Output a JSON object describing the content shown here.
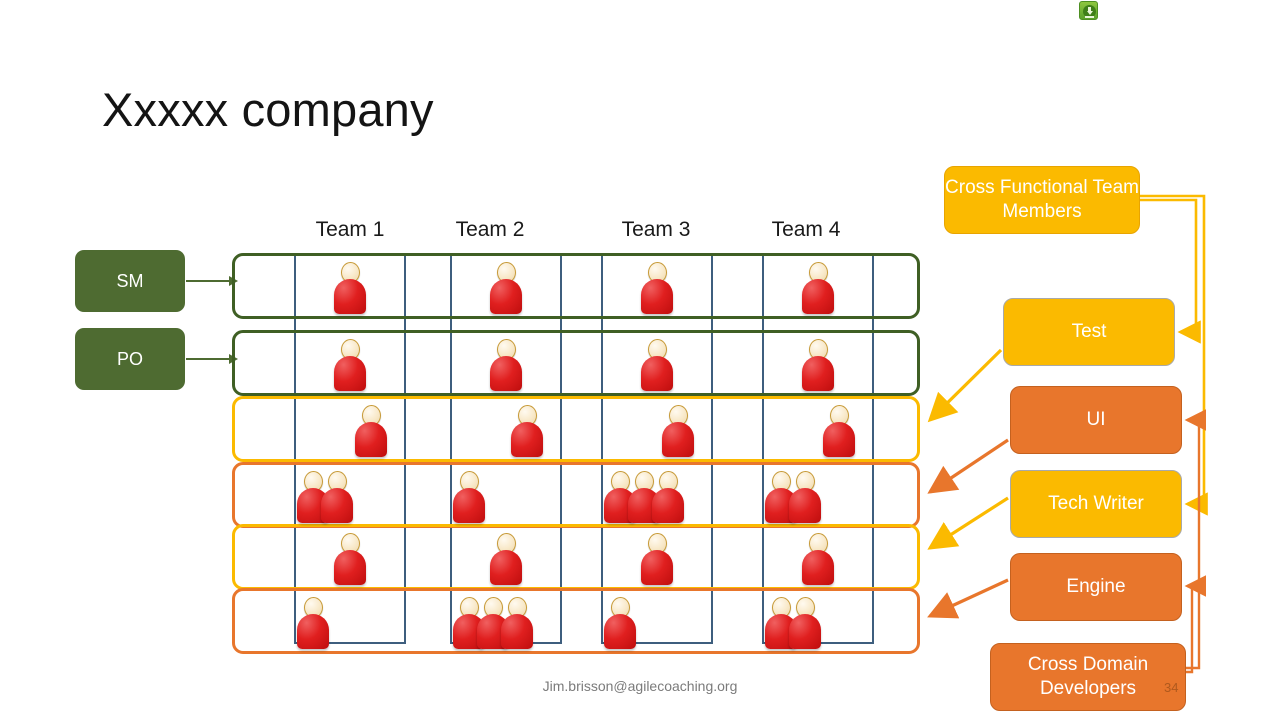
{
  "slide": {
    "title": "Xxxxx company",
    "footer": "Jim.brisson@agilecoaching.org",
    "page_number": "34"
  },
  "icons": {
    "download_badge": "download-icon"
  },
  "roles": [
    {
      "id": "sm",
      "label": "SM",
      "color": "#4e6b31"
    },
    {
      "id": "po",
      "label": "PO",
      "color": "#4e6b31"
    }
  ],
  "teams": [
    {
      "label": "Team 1"
    },
    {
      "label": "Team 2"
    },
    {
      "label": "Team 3"
    },
    {
      "label": "Team 4"
    }
  ],
  "grid": {
    "column_border_color": "#3e5e7e",
    "rows": [
      {
        "id": "row-sm",
        "border_color": "#3f5f24",
        "role": "SM",
        "counts": [
          1,
          1,
          1,
          1
        ],
        "offset": "center"
      },
      {
        "id": "row-po",
        "border_color": "#3f5f24",
        "role": "PO",
        "counts": [
          1,
          1,
          1,
          1
        ],
        "offset": "center"
      },
      {
        "id": "row-test",
        "border_color": "#fbba00",
        "role": "Test",
        "counts": [
          1,
          1,
          1,
          1
        ],
        "offset": "right"
      },
      {
        "id": "row-ui",
        "border_color": "#e8762c",
        "role": "UI",
        "counts": [
          2,
          1,
          3,
          2
        ],
        "offset": "left"
      },
      {
        "id": "row-tw",
        "border_color": "#fbba00",
        "role": "Tech Writer",
        "counts": [
          1,
          1,
          1,
          1
        ],
        "offset": "center"
      },
      {
        "id": "row-eng",
        "border_color": "#e8762c",
        "role": "Engine",
        "counts": [
          1,
          3,
          1,
          2
        ],
        "offset": "left"
      }
    ]
  },
  "functions": [
    {
      "id": "cft",
      "label": "Cross Functional Team Members",
      "fill": "#fbba00",
      "border": "#e8a400"
    },
    {
      "id": "test",
      "label": "Test",
      "fill": "#fbba00",
      "border": "#a9a9a9"
    },
    {
      "id": "ui",
      "label": "UI",
      "fill": "#e8762c",
      "border": "#c4611f"
    },
    {
      "id": "tw",
      "label": "Tech Writer",
      "fill": "#fbba00",
      "border": "#a9a9a9"
    },
    {
      "id": "eng",
      "label": "Engine",
      "fill": "#e8762c",
      "border": "#c4611f"
    },
    {
      "id": "cdd",
      "label": "Cross Domain Developers",
      "fill": "#e8762c",
      "border": "#c4611f"
    }
  ],
  "colors": {
    "green": "#4e6b31",
    "dark_green": "#3f5f24",
    "gold": "#fbba00",
    "orange": "#e8762c",
    "blue": "#3e5e7e",
    "person_red": "#e01f1f",
    "person_head": "#f8e8c8"
  }
}
